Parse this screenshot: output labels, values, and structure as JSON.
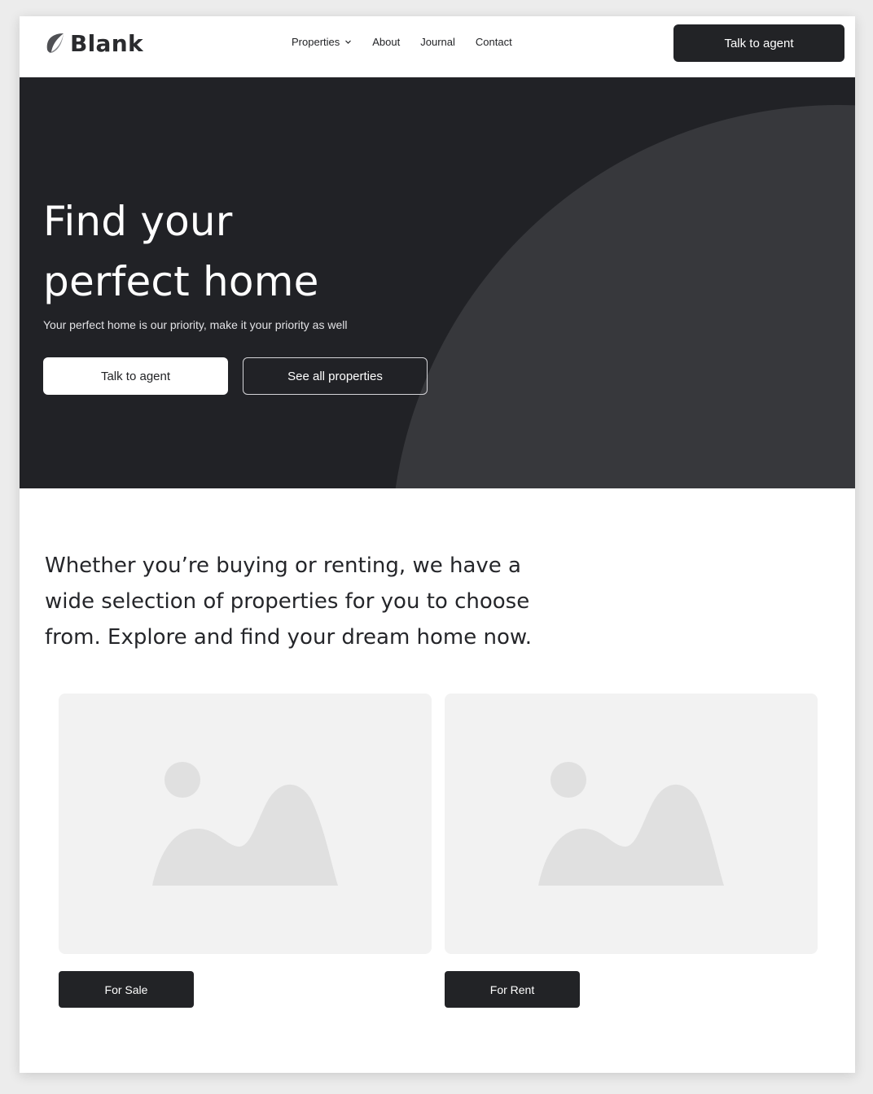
{
  "brand": {
    "name": "Blank",
    "logo_icon": "leaf-icon"
  },
  "nav": {
    "items": [
      {
        "label": "Properties",
        "has_dropdown": true
      },
      {
        "label": "About"
      },
      {
        "label": "Journal"
      },
      {
        "label": "Contact"
      }
    ],
    "cta_label": "Talk to agent"
  },
  "hero": {
    "title_line1": "Find your",
    "title_line2": "perfect home",
    "subtitle": "Your perfect home is our priority, make it your priority as well",
    "primary_label": "Talk to agent",
    "secondary_label": "See all properties"
  },
  "intro": {
    "text": "Whether you’re buying or renting, we have a wide selection of properties for you to choose from. Explore and find your dream home now."
  },
  "cards": [
    {
      "image_icon": "image-placeholder-icon",
      "label": "For Sale"
    },
    {
      "image_icon": "image-placeholder-icon",
      "label": "For Rent"
    }
  ],
  "colors": {
    "dark": "#222326",
    "hero_bg": "#212226",
    "hero_arc": "#37383c",
    "placeholder_bg": "#f2f2f2",
    "placeholder_shape": "#e0e0e0"
  }
}
